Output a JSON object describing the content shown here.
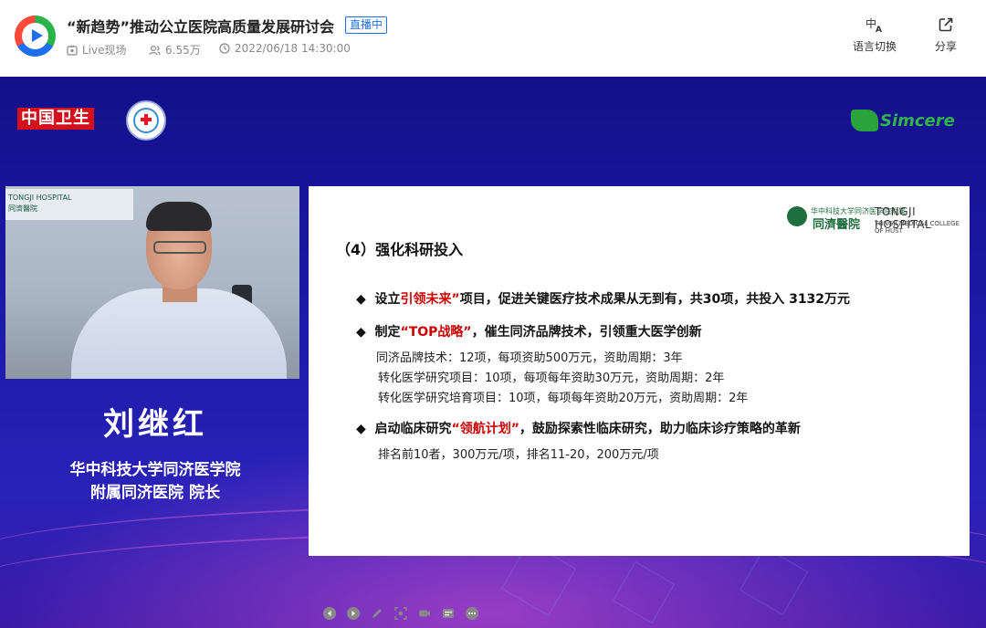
{
  "header": {
    "title": "“新趋势”推动公立医院高质量发展研讨会",
    "live_badge": "直播中",
    "meta": {
      "source": "Live现场",
      "views": "6.55万",
      "datetime": "2022/06/18 14:30:00"
    },
    "buttons": {
      "language": "语言切换",
      "share": "分享"
    }
  },
  "video": {
    "logos": {
      "left": "中国卫生",
      "right": "Simcere"
    },
    "camera_board": {
      "en": "TONGJI HOSPITAL",
      "cn": "同濟醫院"
    },
    "speaker": {
      "name": "刘继红",
      "title_line1": "华中科技大学同济医学院",
      "title_line2": "附属同济医院 院长"
    },
    "slide": {
      "logo_cn_small": "华中科技大学同济医学院附属",
      "logo_name": "同濟醫院",
      "logo_en": "TONGJI HOSPITAL",
      "logo_en_sub": "TONGJI MEDICAL COLLEGE OF HUST",
      "heading": "（4）强化科研投入",
      "bullets": [
        {
          "pre": "设立",
          "hl": "引领未来”",
          "post": "项目，促进关键医疗技术成果从无到有，共30项，共投入 3132万元"
        },
        {
          "pre": "制定",
          "hl": "“TOP战略”",
          "post": "，催生同济品牌技术，引领重大医学创新"
        },
        {
          "pre": "启动临床研究",
          "hl": "“领航计划”",
          "post": "，鼓励探索性临床研究，助力临床诊疗策略的革新"
        }
      ],
      "sub_items": [
        "同济品牌技术：12项，每项资助500万元，资助周期：3年",
        "转化医学研究项目：10项，每项每年资助30万元，资助周期：2年",
        "转化医学研究培育项目：10项，每项每年资助20万元，资助周期：2年",
        "排名前10者，300万元/项，排名11-20，200万元/项"
      ]
    }
  }
}
